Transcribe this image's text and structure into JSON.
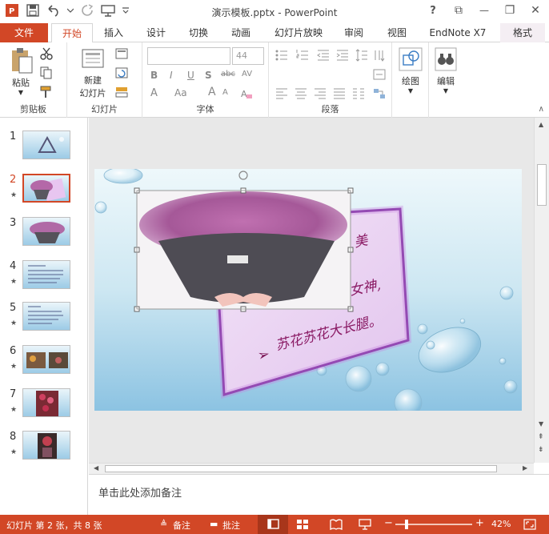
{
  "window": {
    "title": "演示模板.pptx - PowerPoint",
    "help": "?",
    "ribbon_display": "⧉",
    "minimize": "—",
    "restore": "❐",
    "close": "✕"
  },
  "tabs": [
    {
      "label": "文件"
    },
    {
      "label": "开始"
    },
    {
      "label": "插入"
    },
    {
      "label": "设计"
    },
    {
      "label": "切换"
    },
    {
      "label": "动画"
    },
    {
      "label": "幻灯片放映"
    },
    {
      "label": "审阅"
    },
    {
      "label": "视图"
    },
    {
      "label": "EndNote X7"
    },
    {
      "label": "格式"
    }
  ],
  "ribbon": {
    "clipboard": {
      "paste": "粘贴",
      "group": "剪贴板"
    },
    "slides": {
      "new_slide_line1": "新建",
      "new_slide_line2": "幻灯片",
      "group": "幻灯片"
    },
    "font": {
      "font_size": "44",
      "group": "字体",
      "bold": "B",
      "italic": "I",
      "underline": "U",
      "shadow": "S",
      "strike": "abc",
      "spacing": "AV",
      "font_color": "A",
      "change_case": "Aa",
      "grow": "A",
      "shrink": "A"
    },
    "paragraph": {
      "group": "段落"
    },
    "drawing": {
      "label": "绘图"
    },
    "editing": {
      "label": "编辑"
    }
  },
  "thumbnails": [
    {
      "num": "1",
      "star": ""
    },
    {
      "num": "2",
      "star": "★"
    },
    {
      "num": "3",
      "star": ""
    },
    {
      "num": "4",
      "star": "★"
    },
    {
      "num": "5",
      "star": "★"
    },
    {
      "num": "6",
      "star": "★"
    },
    {
      "num": "7",
      "star": "★"
    },
    {
      "num": "8",
      "star": "★"
    }
  ],
  "slide": {
    "line1": "美",
    "line2": "女神,",
    "line3": "苏花苏花大长腿。",
    "arrow": "➢"
  },
  "notes": {
    "placeholder": "单击此处添加备注"
  },
  "status": {
    "slide_info": "幻灯片 第 2 张，共 8 张",
    "notes": "备注",
    "comments": "批注",
    "zoom": "42%"
  },
  "colors": {
    "accent": "#d24726",
    "frame_purple": "#7a2d9c",
    "text_purple": "#8a1a64"
  }
}
